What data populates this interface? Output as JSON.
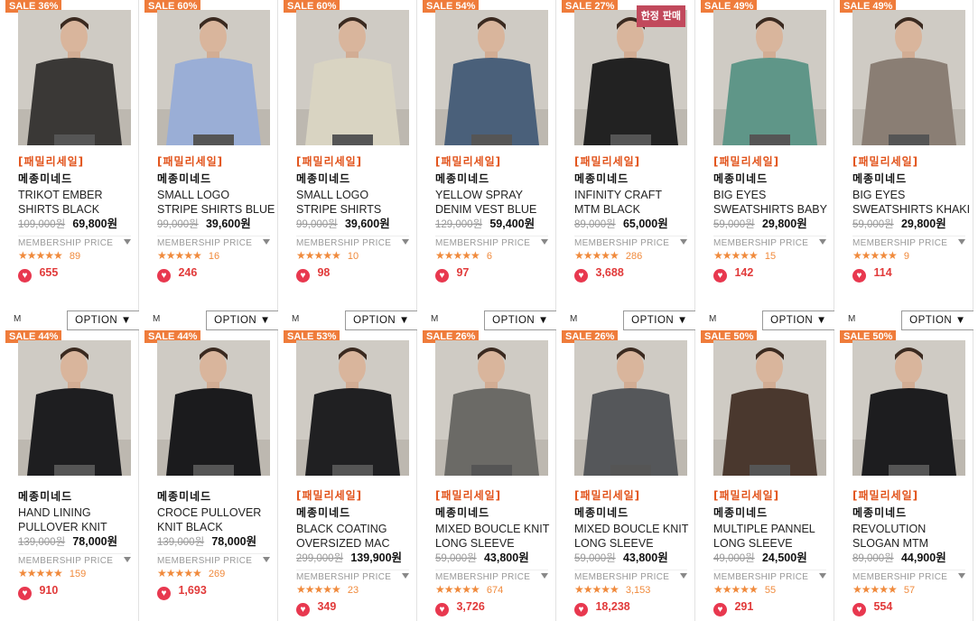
{
  "colors": {
    "sale_badge": "#ef7c3b",
    "limited_badge": "#c1495c",
    "promo_text": "#e2541c",
    "star": "#f08a3c",
    "heart": "#e8384f"
  },
  "common": {
    "membership_label": "MEMBERSHIP PRICE",
    "stars": "★★★★★",
    "option_label": "OPTION ▼",
    "size_label": "M"
  },
  "products": [
    {
      "sale": "SALE 36%",
      "limited": "",
      "promo": "[패밀리세일]",
      "brand": "메종미네드",
      "name1": "TRIKOT EMBER",
      "name2": "SHIRTS BLACK",
      "orig": "109,000원",
      "price": "69,800원",
      "reviews": "89",
      "likes": "655",
      "color": "#3a3836"
    },
    {
      "sale": "SALE 60%",
      "limited": "",
      "promo": "[패밀리세일]",
      "brand": "메종미네드",
      "name1": "SMALL LOGO",
      "name2": "STRIPE SHIRTS BLUE",
      "orig": "99,000원",
      "price": "39,600원",
      "reviews": "16",
      "likes": "246",
      "color": "#9aaed6"
    },
    {
      "sale": "SALE 60%",
      "limited": "",
      "promo": "[패밀리세일]",
      "brand": "메종미네드",
      "name1": "SMALL LOGO",
      "name2": "STRIPE SHIRTS",
      "orig": "99,000원",
      "price": "39,600원",
      "reviews": "10",
      "likes": "98",
      "color": "#d9d4c2"
    },
    {
      "sale": "SALE 54%",
      "limited": "",
      "promo": "[패밀리세일]",
      "brand": "메종미네드",
      "name1": "YELLOW SPRAY",
      "name2": "DENIM VEST BLUE",
      "orig": "129,000원",
      "price": "59,400원",
      "reviews": "6",
      "likes": "97",
      "color": "#4a607a"
    },
    {
      "sale": "SALE 27%",
      "limited": "한정 판매",
      "promo": "[패밀리세일]",
      "brand": "메종미네드",
      "name1": "INFINITY CRAFT",
      "name2": "MTM BLACK",
      "orig": "89,000원",
      "price": "65,000원",
      "reviews": "286",
      "likes": "3,688",
      "color": "#222222"
    },
    {
      "sale": "SALE 49%",
      "limited": "",
      "promo": "[패밀리세일]",
      "brand": "메종미네드",
      "name1": "BIG EYES",
      "name2": "SWEATSHIRTS BABY",
      "orig": "59,000원",
      "price": "29,800원",
      "reviews": "15",
      "likes": "142",
      "color": "#5f9688"
    },
    {
      "sale": "SALE 49%",
      "limited": "",
      "promo": "[패밀리세일]",
      "brand": "메종미네드",
      "name1": "BIG EYES",
      "name2": "SWEATSHIRTS KHAKI",
      "orig": "59,000원",
      "price": "29,800원",
      "reviews": "9",
      "likes": "114",
      "color": "#8a7e74"
    },
    {
      "sale": "SALE 44%",
      "limited": "",
      "promo": "",
      "brand": "메종미네드",
      "name1": "HAND LINING",
      "name2": "PULLOVER KNIT",
      "orig": "139,000원",
      "price": "78,000원",
      "reviews": "159",
      "likes": "910",
      "color": "#1e1e20"
    },
    {
      "sale": "SALE 44%",
      "limited": "",
      "promo": "",
      "brand": "메종미네드",
      "name1": "CROCE PULLOVER",
      "name2": "KNIT BLACK",
      "orig": "139,000원",
      "price": "78,000원",
      "reviews": "269",
      "likes": "1,693",
      "color": "#1b1b1d"
    },
    {
      "sale": "SALE 53%",
      "limited": "",
      "promo": "[패밀리세일]",
      "brand": "메종미네드",
      "name1": "BLACK COATING",
      "name2": "OVERSIZED MAC",
      "orig": "299,000원",
      "price": "139,900원",
      "reviews": "23",
      "likes": "349",
      "color": "#202022"
    },
    {
      "sale": "SALE 26%",
      "limited": "",
      "promo": "[패밀리세일]",
      "brand": "메종미네드",
      "name1": "MIXED BOUCLE KNIT",
      "name2": "LONG SLEEVE",
      "orig": "59,000원",
      "price": "43,800원",
      "reviews": "674",
      "likes": "3,726",
      "color": "#6b6a66"
    },
    {
      "sale": "SALE 26%",
      "limited": "",
      "promo": "[패밀리세일]",
      "brand": "메종미네드",
      "name1": "MIXED BOUCLE KNIT",
      "name2": "LONG SLEEVE",
      "orig": "59,000원",
      "price": "43,800원",
      "reviews": "3,153",
      "likes": "18,238",
      "color": "#55575a"
    },
    {
      "sale": "SALE 50%",
      "limited": "",
      "promo": "[패밀리세일]",
      "brand": "메종미네드",
      "name1": "MULTIPLE PANNEL",
      "name2": "LONG SLEEVE",
      "orig": "49,000원",
      "price": "24,500원",
      "reviews": "55",
      "likes": "291",
      "color": "#4a382e"
    },
    {
      "sale": "SALE 50%",
      "limited": "",
      "promo": "[패밀리세일]",
      "brand": "메종미네드",
      "name1": "REVOLUTION",
      "name2": "SLOGAN MTM",
      "orig": "89,000원",
      "price": "44,900원",
      "reviews": "57",
      "likes": "554",
      "color": "#1d1d1f"
    }
  ]
}
